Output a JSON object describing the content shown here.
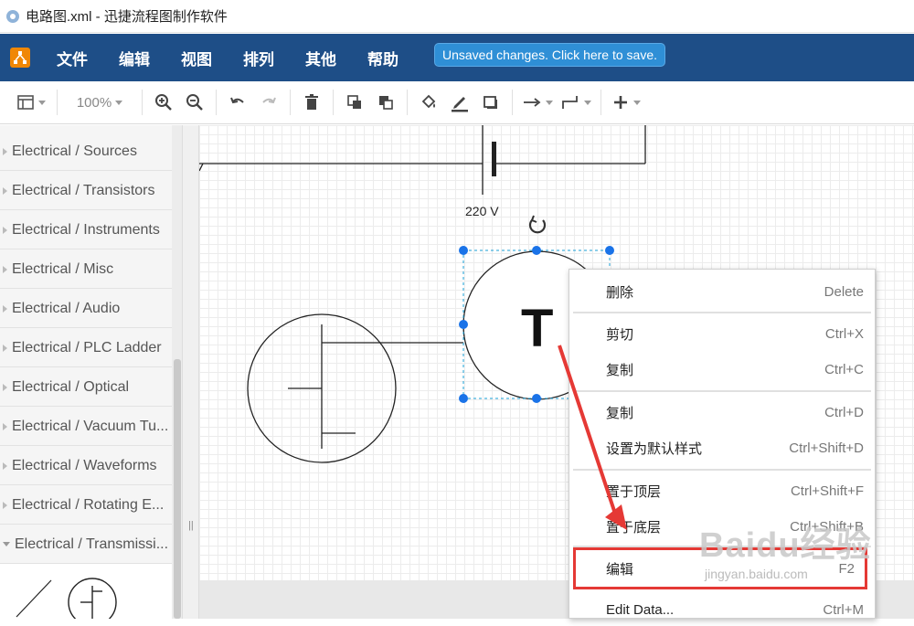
{
  "window": {
    "title": "电路图.xml - 迅捷流程图制作软件"
  },
  "menubar": {
    "items": [
      "文件",
      "编辑",
      "视图",
      "排列",
      "其他",
      "帮助"
    ],
    "save_banner": "Unsaved changes. Click here to save."
  },
  "toolbar": {
    "zoom": "100%"
  },
  "sidebar": {
    "items": [
      "Electrical / Sources",
      "Electrical / Transistors",
      "Electrical / Instruments",
      "Electrical / Misc",
      "Electrical / Audio",
      "Electrical / PLC Ladder",
      "Electrical / Optical",
      "Electrical / Vacuum Tu...",
      "Electrical / Waveforms",
      "Electrical / Rotating E...",
      "Electrical / Transmissi..."
    ]
  },
  "canvas": {
    "voltage_label": "220 V",
    "selected_shape_letter": "T"
  },
  "context_menu": {
    "items": [
      {
        "label": "删除",
        "shortcut": "Delete"
      },
      {
        "label": "剪切",
        "shortcut": "Ctrl+X"
      },
      {
        "label": "复制",
        "shortcut": "Ctrl+C"
      },
      {
        "label": "复制",
        "shortcut": "Ctrl+D"
      },
      {
        "label": "设置为默认样式",
        "shortcut": "Ctrl+Shift+D"
      },
      {
        "label": "置于顶层",
        "shortcut": "Ctrl+Shift+F"
      },
      {
        "label": "置于底层",
        "shortcut": "Ctrl+Shift+B"
      },
      {
        "label": "编辑",
        "shortcut": "F2"
      },
      {
        "label": "Edit Data...",
        "shortcut": "Ctrl+M"
      }
    ]
  },
  "watermark": {
    "logo": "Baidu经验",
    "url": "jingyan.baidu.com"
  },
  "colors": {
    "menubar": "#1e4e87",
    "accent": "#2f8fd6",
    "highlight": "#e53935",
    "selection": "#1a73e8"
  }
}
